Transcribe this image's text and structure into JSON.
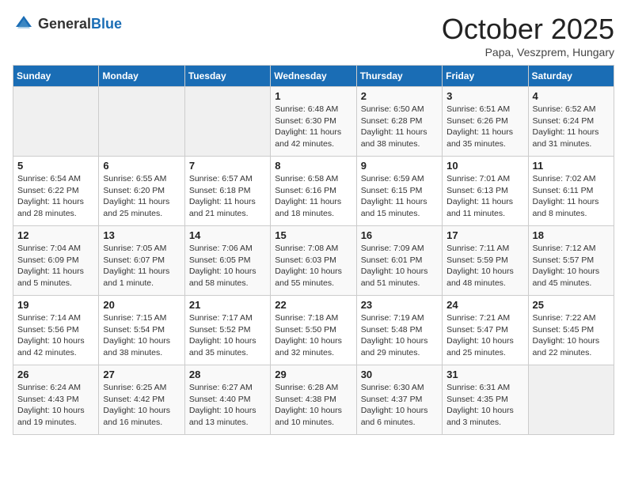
{
  "header": {
    "logo_general": "General",
    "logo_blue": "Blue",
    "title": "October 2025",
    "subtitle": "Papa, Veszprem, Hungary"
  },
  "days_of_week": [
    "Sunday",
    "Monday",
    "Tuesday",
    "Wednesday",
    "Thursday",
    "Friday",
    "Saturday"
  ],
  "weeks": [
    [
      {
        "day": "",
        "info": ""
      },
      {
        "day": "",
        "info": ""
      },
      {
        "day": "",
        "info": ""
      },
      {
        "day": "1",
        "info": "Sunrise: 6:48 AM\nSunset: 6:30 PM\nDaylight: 11 hours\nand 42 minutes."
      },
      {
        "day": "2",
        "info": "Sunrise: 6:50 AM\nSunset: 6:28 PM\nDaylight: 11 hours\nand 38 minutes."
      },
      {
        "day": "3",
        "info": "Sunrise: 6:51 AM\nSunset: 6:26 PM\nDaylight: 11 hours\nand 35 minutes."
      },
      {
        "day": "4",
        "info": "Sunrise: 6:52 AM\nSunset: 6:24 PM\nDaylight: 11 hours\nand 31 minutes."
      }
    ],
    [
      {
        "day": "5",
        "info": "Sunrise: 6:54 AM\nSunset: 6:22 PM\nDaylight: 11 hours\nand 28 minutes."
      },
      {
        "day": "6",
        "info": "Sunrise: 6:55 AM\nSunset: 6:20 PM\nDaylight: 11 hours\nand 25 minutes."
      },
      {
        "day": "7",
        "info": "Sunrise: 6:57 AM\nSunset: 6:18 PM\nDaylight: 11 hours\nand 21 minutes."
      },
      {
        "day": "8",
        "info": "Sunrise: 6:58 AM\nSunset: 6:16 PM\nDaylight: 11 hours\nand 18 minutes."
      },
      {
        "day": "9",
        "info": "Sunrise: 6:59 AM\nSunset: 6:15 PM\nDaylight: 11 hours\nand 15 minutes."
      },
      {
        "day": "10",
        "info": "Sunrise: 7:01 AM\nSunset: 6:13 PM\nDaylight: 11 hours\nand 11 minutes."
      },
      {
        "day": "11",
        "info": "Sunrise: 7:02 AM\nSunset: 6:11 PM\nDaylight: 11 hours\nand 8 minutes."
      }
    ],
    [
      {
        "day": "12",
        "info": "Sunrise: 7:04 AM\nSunset: 6:09 PM\nDaylight: 11 hours\nand 5 minutes."
      },
      {
        "day": "13",
        "info": "Sunrise: 7:05 AM\nSunset: 6:07 PM\nDaylight: 11 hours\nand 1 minute."
      },
      {
        "day": "14",
        "info": "Sunrise: 7:06 AM\nSunset: 6:05 PM\nDaylight: 10 hours\nand 58 minutes."
      },
      {
        "day": "15",
        "info": "Sunrise: 7:08 AM\nSunset: 6:03 PM\nDaylight: 10 hours\nand 55 minutes."
      },
      {
        "day": "16",
        "info": "Sunrise: 7:09 AM\nSunset: 6:01 PM\nDaylight: 10 hours\nand 51 minutes."
      },
      {
        "day": "17",
        "info": "Sunrise: 7:11 AM\nSunset: 5:59 PM\nDaylight: 10 hours\nand 48 minutes."
      },
      {
        "day": "18",
        "info": "Sunrise: 7:12 AM\nSunset: 5:57 PM\nDaylight: 10 hours\nand 45 minutes."
      }
    ],
    [
      {
        "day": "19",
        "info": "Sunrise: 7:14 AM\nSunset: 5:56 PM\nDaylight: 10 hours\nand 42 minutes."
      },
      {
        "day": "20",
        "info": "Sunrise: 7:15 AM\nSunset: 5:54 PM\nDaylight: 10 hours\nand 38 minutes."
      },
      {
        "day": "21",
        "info": "Sunrise: 7:17 AM\nSunset: 5:52 PM\nDaylight: 10 hours\nand 35 minutes."
      },
      {
        "day": "22",
        "info": "Sunrise: 7:18 AM\nSunset: 5:50 PM\nDaylight: 10 hours\nand 32 minutes."
      },
      {
        "day": "23",
        "info": "Sunrise: 7:19 AM\nSunset: 5:48 PM\nDaylight: 10 hours\nand 29 minutes."
      },
      {
        "day": "24",
        "info": "Sunrise: 7:21 AM\nSunset: 5:47 PM\nDaylight: 10 hours\nand 25 minutes."
      },
      {
        "day": "25",
        "info": "Sunrise: 7:22 AM\nSunset: 5:45 PM\nDaylight: 10 hours\nand 22 minutes."
      }
    ],
    [
      {
        "day": "26",
        "info": "Sunrise: 6:24 AM\nSunset: 4:43 PM\nDaylight: 10 hours\nand 19 minutes."
      },
      {
        "day": "27",
        "info": "Sunrise: 6:25 AM\nSunset: 4:42 PM\nDaylight: 10 hours\nand 16 minutes."
      },
      {
        "day": "28",
        "info": "Sunrise: 6:27 AM\nSunset: 4:40 PM\nDaylight: 10 hours\nand 13 minutes."
      },
      {
        "day": "29",
        "info": "Sunrise: 6:28 AM\nSunset: 4:38 PM\nDaylight: 10 hours\nand 10 minutes."
      },
      {
        "day": "30",
        "info": "Sunrise: 6:30 AM\nSunset: 4:37 PM\nDaylight: 10 hours\nand 6 minutes."
      },
      {
        "day": "31",
        "info": "Sunrise: 6:31 AM\nSunset: 4:35 PM\nDaylight: 10 hours\nand 3 minutes."
      },
      {
        "day": "",
        "info": ""
      }
    ]
  ]
}
